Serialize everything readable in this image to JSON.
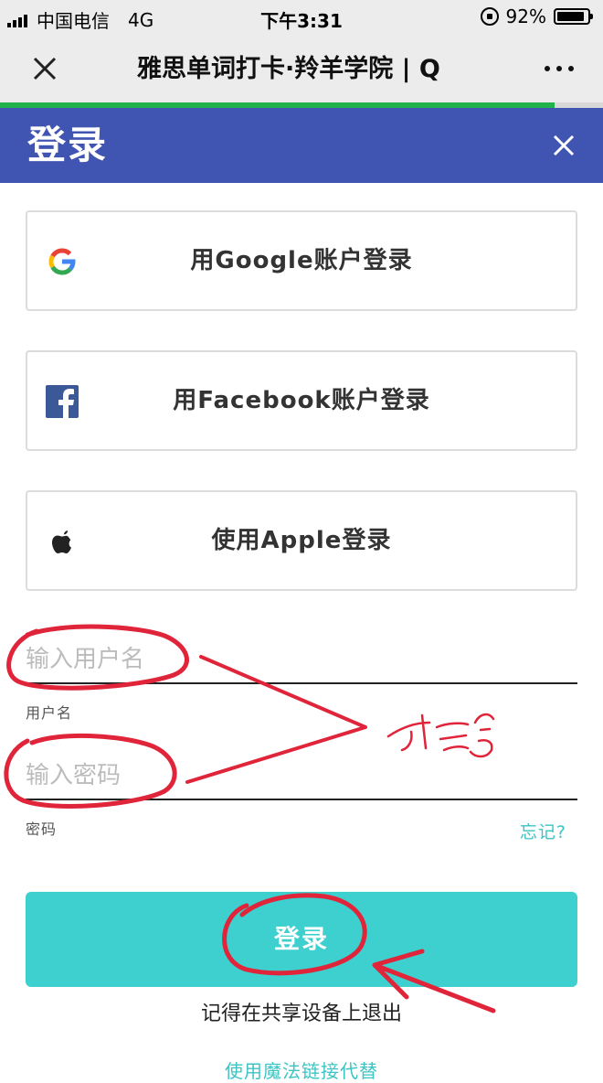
{
  "status_bar": {
    "carrier": "中国电信",
    "network": "4G",
    "time": "下午3:31",
    "battery": "92%",
    "battery_level": 0.92
  },
  "nav": {
    "title": "雅思单词打卡·羚羊学院 | Q",
    "close_icon": "close-icon",
    "more_icon": "more-icon"
  },
  "page_load_progress": 0.92,
  "modal": {
    "title": "登录"
  },
  "social": {
    "google": "用Google账户登录",
    "facebook": "用Facebook账户登录",
    "apple": "使用Apple登录"
  },
  "form": {
    "username_placeholder": "输入用户名",
    "username_caption": "用户名",
    "password_placeholder": "输入密码",
    "password_caption": "密码",
    "forgot": "忘记?",
    "login_button": "登录",
    "remember": "记得在共享设备上退出",
    "magic_link": "使用魔法链接代替"
  },
  "colors": {
    "header_bg": "#4054b2",
    "accent": "#3ecfcf",
    "annotation": "#e0253a"
  }
}
